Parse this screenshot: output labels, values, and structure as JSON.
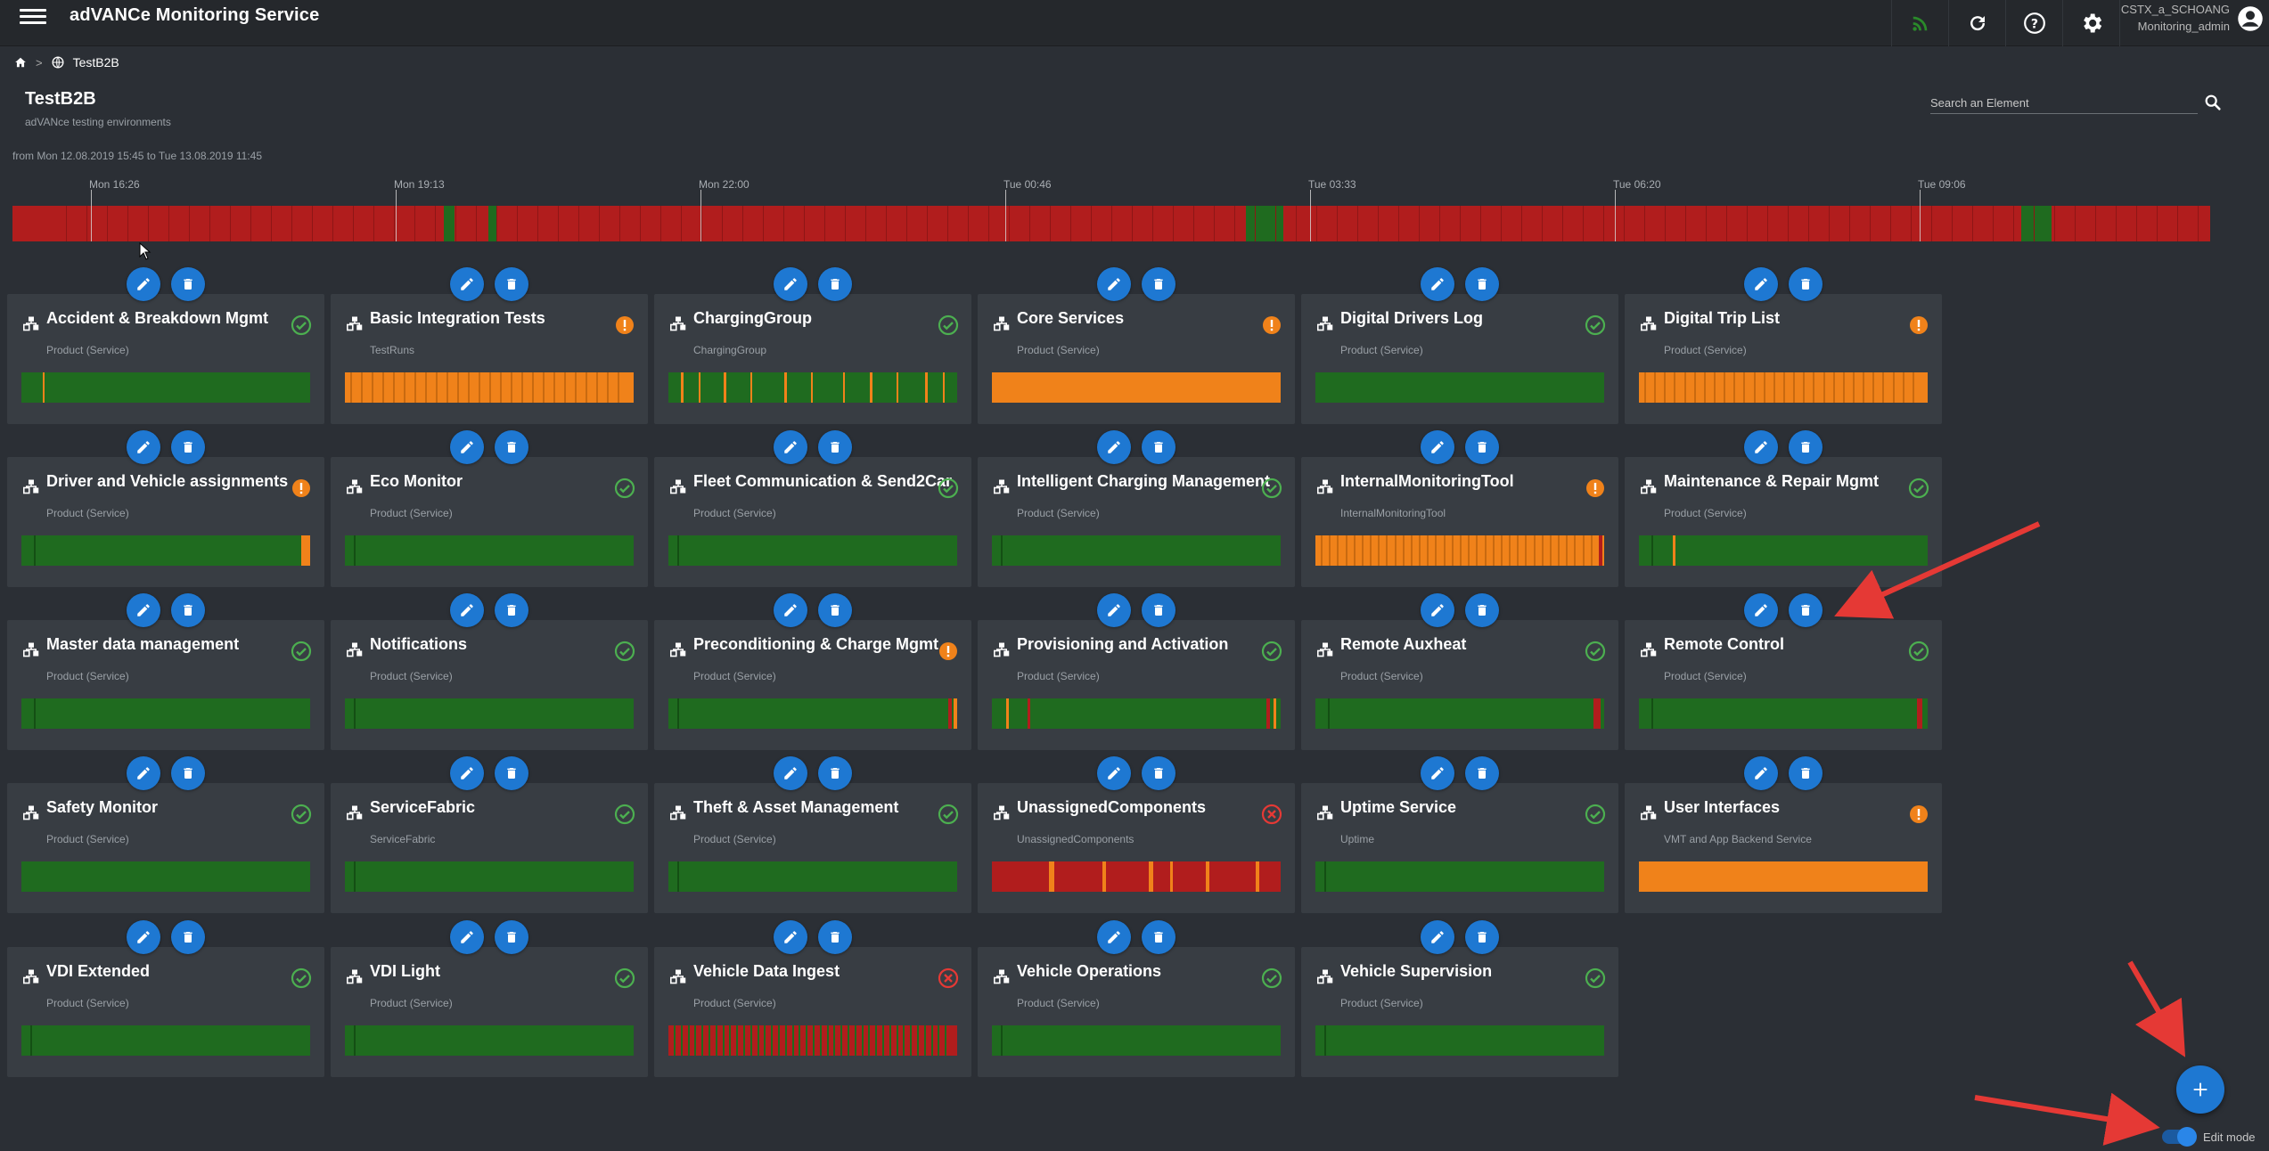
{
  "app": {
    "title": "adVANCe Monitoring Service"
  },
  "user": {
    "name": "CSTX_a_SCHOANG",
    "role": "Monitoring_admin"
  },
  "breadcrumb": {
    "separator": ">",
    "current": "TestB2B"
  },
  "page": {
    "title": "TestB2B",
    "subtitle": "adVANce testing environments"
  },
  "search": {
    "placeholder": "Search an Element"
  },
  "range": {
    "text": "from Mon 12.08.2019 15:45 to Tue 13.08.2019 11:45"
  },
  "timeline": {
    "ticks": [
      "Mon 16:26",
      "Mon 19:13",
      "Mon 22:00",
      "Tue 00:46",
      "Tue 03:33",
      "Tue 06:20",
      "Tue 09:06"
    ]
  },
  "colors": {
    "ok": "#1f6b1f",
    "warn": "#f0821a",
    "error": "#b11d1d",
    "accent": "#1e78d2"
  },
  "cards": [
    {
      "title": "Accident & Breakdown Mgmt",
      "subtitle": "Product (Service)",
      "status": "ok"
    },
    {
      "title": "Basic Integration Tests",
      "subtitle": "TestRuns",
      "status": "warn"
    },
    {
      "title": "ChargingGroup",
      "subtitle": "ChargingGroup",
      "status": "ok"
    },
    {
      "title": "Core Services",
      "subtitle": "Product (Service)",
      "status": "warn"
    },
    {
      "title": "Digital Drivers Log",
      "subtitle": "Product (Service)",
      "status": "ok"
    },
    {
      "title": "Digital Trip List",
      "subtitle": "Product (Service)",
      "status": "warn"
    },
    {
      "title": "Driver and Vehicle assignments",
      "subtitle": "Product (Service)",
      "status": "warn"
    },
    {
      "title": "Eco Monitor",
      "subtitle": "Product (Service)",
      "status": "ok"
    },
    {
      "title": "Fleet Communication & Send2Car",
      "subtitle": "Product (Service)",
      "status": "ok"
    },
    {
      "title": "Intelligent Charging Management",
      "subtitle": "Product (Service)",
      "status": "ok"
    },
    {
      "title": "InternalMonitoringTool",
      "subtitle": "InternalMonitoringTool",
      "status": "warn"
    },
    {
      "title": "Maintenance & Repair Mgmt",
      "subtitle": "Product (Service)",
      "status": "ok"
    },
    {
      "title": "Master data management",
      "subtitle": "Product (Service)",
      "status": "ok"
    },
    {
      "title": "Notifications",
      "subtitle": "Product (Service)",
      "status": "ok"
    },
    {
      "title": "Preconditioning & Charge Mgmt",
      "subtitle": "Product (Service)",
      "status": "warn"
    },
    {
      "title": "Provisioning and Activation",
      "subtitle": "Product (Service)",
      "status": "ok"
    },
    {
      "title": "Remote Auxheat",
      "subtitle": "Product (Service)",
      "status": "ok"
    },
    {
      "title": "Remote Control",
      "subtitle": "Product (Service)",
      "status": "ok"
    },
    {
      "title": "Safety Monitor",
      "subtitle": "Product (Service)",
      "status": "ok"
    },
    {
      "title": "ServiceFabric",
      "subtitle": "ServiceFabric",
      "status": "ok"
    },
    {
      "title": "Theft & Asset Management",
      "subtitle": "Product (Service)",
      "status": "ok"
    },
    {
      "title": "UnassignedComponents",
      "subtitle": "UnassignedComponents",
      "status": "error"
    },
    {
      "title": "Uptime Service",
      "subtitle": "Uptime",
      "status": "ok"
    },
    {
      "title": "User Interfaces",
      "subtitle": "VMT and App Backend Service",
      "status": "warn"
    },
    {
      "title": "VDI Extended",
      "subtitle": "Product (Service)",
      "status": "ok"
    },
    {
      "title": "VDI Light",
      "subtitle": "Product (Service)",
      "status": "ok"
    },
    {
      "title": "Vehicle Data Ingest",
      "subtitle": "Product (Service)",
      "status": "error"
    },
    {
      "title": "Vehicle Operations",
      "subtitle": "Product (Service)",
      "status": "ok"
    },
    {
      "title": "Vehicle Supervision",
      "subtitle": "Product (Service)",
      "status": "ok"
    }
  ],
  "edit_mode": {
    "label": "Edit mode",
    "enabled": true
  }
}
